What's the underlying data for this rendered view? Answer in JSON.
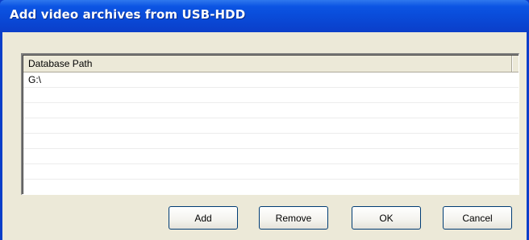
{
  "window": {
    "title": "Add video archives from USB-HDD",
    "accent_color": "#0b3ec9"
  },
  "list": {
    "column_header": "Database Path",
    "rows": [
      "G:\\",
      "",
      "",
      "",
      "",
      "",
      "",
      ""
    ]
  },
  "buttons": {
    "add": "Add",
    "remove": "Remove",
    "ok": "OK",
    "cancel": "Cancel"
  }
}
